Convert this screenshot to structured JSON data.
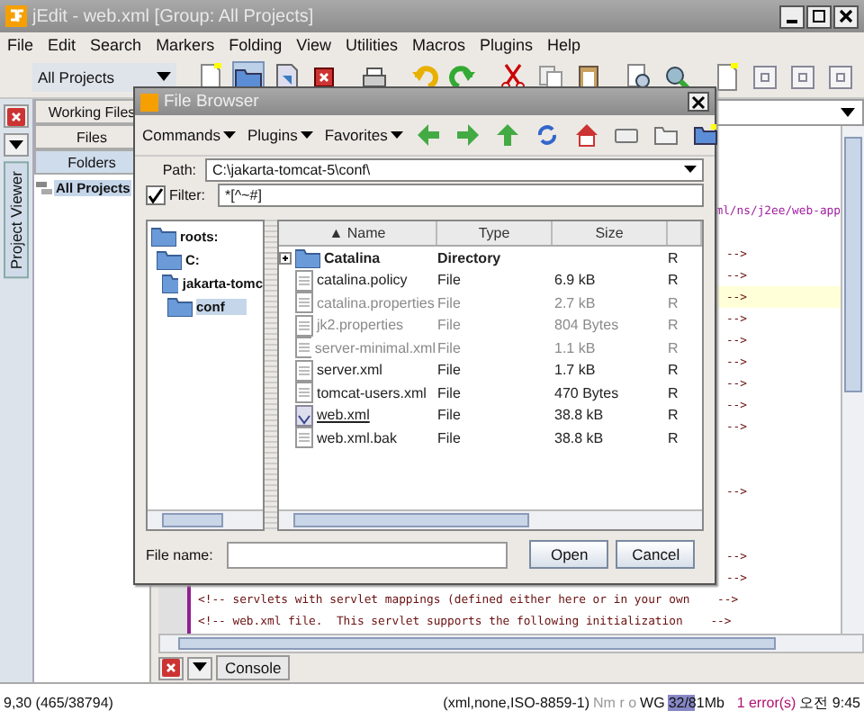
{
  "window": {
    "title": "jEdit - web.xml [Group: All Projects]"
  },
  "menu": [
    "File",
    "Edit",
    "Search",
    "Markers",
    "Folding",
    "View",
    "Utilities",
    "Macros",
    "Plugins",
    "Help"
  ],
  "project_viewer": {
    "group": "All Projects",
    "side_tab": "Project Viewer",
    "tabs": [
      {
        "label": "Working Files",
        "selected": false
      },
      {
        "label": "Files",
        "selected": false
      },
      {
        "label": "Folders",
        "selected": true
      }
    ],
    "tree": [
      {
        "label": "All Projects",
        "selected": true
      }
    ]
  },
  "editor": {
    "lines": [
      {
        "kind": "blank"
      },
      {
        "kind": "blank"
      },
      {
        "kind": "blank"
      },
      {
        "kind": "blank"
      },
      {
        "kind": "edge",
        "text": "ml/ns/j2ee/web-app",
        "current": false
      },
      {
        "kind": "blank"
      },
      {
        "kind": "tail",
        "text": "-->",
        "current": false
      },
      {
        "kind": "tail",
        "text": "-->",
        "current": false
      },
      {
        "kind": "tail",
        "text": "-->",
        "current": true
      },
      {
        "kind": "tail",
        "text": "-->",
        "current": false
      },
      {
        "kind": "tail",
        "text": "-->",
        "current": false
      },
      {
        "kind": "tail",
        "text": "-->",
        "current": false
      },
      {
        "kind": "tail",
        "text": "-->",
        "current": false
      },
      {
        "kind": "tail",
        "text": "-->",
        "current": false
      },
      {
        "kind": "tail",
        "text": "-->",
        "current": false
      },
      {
        "kind": "blank"
      },
      {
        "kind": "blank"
      },
      {
        "kind": "tail",
        "text": "-->",
        "current": false
      },
      {
        "kind": "blank"
      },
      {
        "kind": "blank"
      },
      {
        "kind": "tail",
        "text": "-->",
        "current": false
      },
      {
        "kind": "tail",
        "text": "-->",
        "current": false
      },
      {
        "kind": "full",
        "text": "<!-- servlets with servlet mappings (defined either here or in your own    -->",
        "current": false
      },
      {
        "kind": "full",
        "text": "<!-- web.xml file.  This servlet supports the following initialization    -->",
        "current": false
      }
    ],
    "console_tab": "Console"
  },
  "file_browser": {
    "title": "File Browser",
    "menus": [
      "Commands",
      "Plugins",
      "Favorites"
    ],
    "path_label": "Path:",
    "path": "C:\\jakarta-tomcat-5\\conf\\",
    "filter_label": "Filter:",
    "filter_checked": true,
    "filter": "*[^~#]",
    "tree": [
      {
        "label": "roots:",
        "selected": false,
        "children": [
          {
            "label": "C:",
            "selected": false,
            "children": [
              {
                "label": "jakarta-tomc",
                "selected": false,
                "children": [
                  {
                    "label": "conf",
                    "selected": true
                  }
                ]
              }
            ]
          }
        ]
      }
    ],
    "columns": [
      "▲ Name",
      "Type",
      "Size"
    ],
    "rows": [
      {
        "kind": "folder",
        "name": "Catalina",
        "type": "Directory",
        "size": "",
        "column_4": "R",
        "dimmed": false,
        "open": false
      },
      {
        "kind": "file",
        "name": "catalina.policy",
        "type": "File",
        "size": "6.9 kB",
        "column_4": "R",
        "dimmed": false,
        "open": false
      },
      {
        "kind": "file",
        "name": "catalina.properties",
        "type": "File",
        "size": "2.7 kB",
        "column_4": "R",
        "dimmed": true,
        "open": false
      },
      {
        "kind": "file",
        "name": "jk2.properties",
        "type": "File",
        "size": "804 Bytes",
        "column_4": "R",
        "dimmed": true,
        "open": false
      },
      {
        "kind": "file",
        "name": "server-minimal.xml",
        "type": "File",
        "size": "1.1 kB",
        "column_4": "R",
        "dimmed": true,
        "open": false
      },
      {
        "kind": "file",
        "name": "server.xml",
        "type": "File",
        "size": "1.7 kB",
        "column_4": "R",
        "dimmed": false,
        "open": false
      },
      {
        "kind": "file",
        "name": "tomcat-users.xml",
        "type": "File",
        "size": "470 Bytes",
        "column_4": "R",
        "dimmed": false,
        "open": false
      },
      {
        "kind": "xml",
        "name": "web.xml",
        "type": "File",
        "size": "38.8 kB",
        "column_4": "R",
        "dimmed": false,
        "open": true
      },
      {
        "kind": "file",
        "name": "web.xml.bak",
        "type": "File",
        "size": "38.8 kB",
        "column_4": "R",
        "dimmed": false,
        "open": false
      }
    ],
    "file_name_label": "File name:",
    "buttons": [
      "Open",
      "Cancel"
    ]
  },
  "status_bar": {
    "position": "9,30 (465/38794)",
    "mode": "(xml,none,ISO-8859-1)",
    "flags": "Nm r o",
    "wrap": "WG",
    "memory_meter": {
      "reading": "32/81Mb",
      "level": 0.4
    },
    "errors": "1 error(s)",
    "clock": "오전 9:45"
  }
}
